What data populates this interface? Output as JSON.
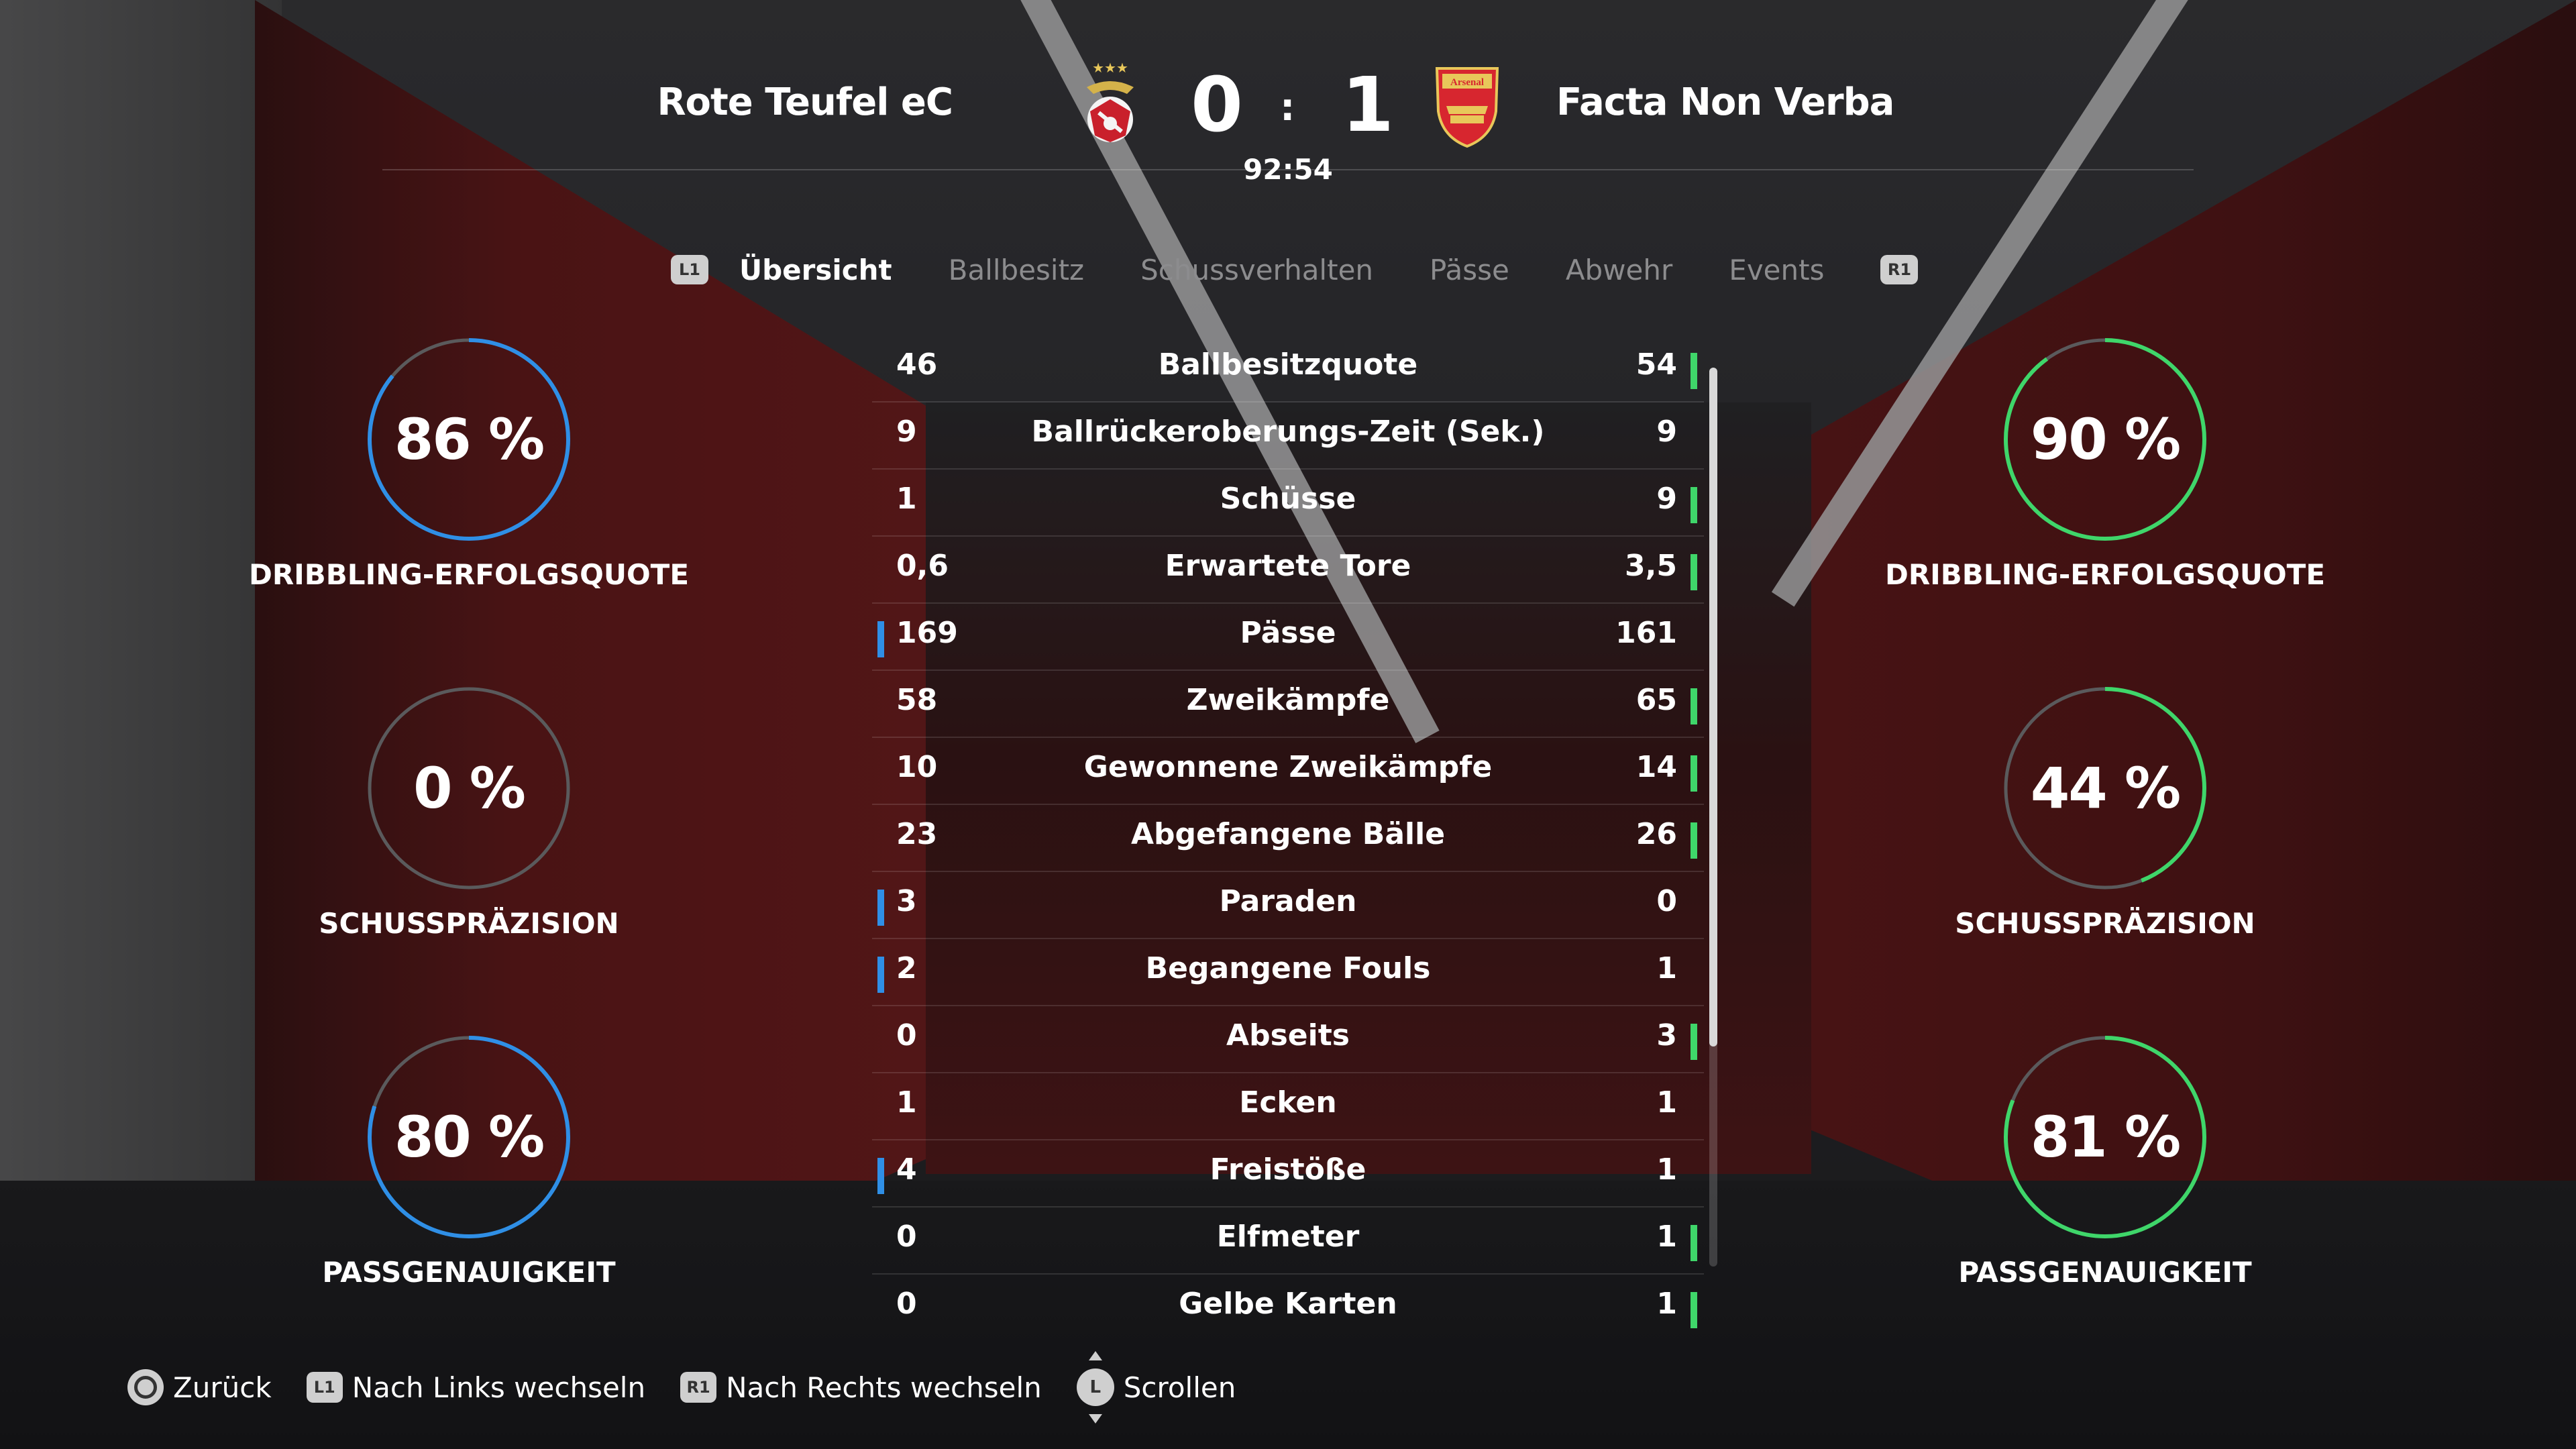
{
  "match": {
    "home_team": "Rote Teufel eC",
    "away_team": "Facta Non Verba",
    "home_score": "0",
    "separator": ":",
    "away_score": "1",
    "clock": "92:54",
    "home_crest": "benfica-crest-icon",
    "away_crest": "arsenal-crest-icon",
    "away_crest_text": "Arsenal"
  },
  "tabs": {
    "left_button": "L1",
    "right_button": "R1",
    "items": [
      "Übersicht",
      "Ballbesitz",
      "Schussverhalten",
      "Pässe",
      "Abwehr",
      "Events"
    ],
    "active": "Übersicht"
  },
  "stats": [
    {
      "name": "Ballbesitzquote",
      "home": "46",
      "away": "54",
      "lead": "away"
    },
    {
      "name": "Ballrückeroberungs-Zeit (Sek.)",
      "home": "9",
      "away": "9",
      "lead": "none"
    },
    {
      "name": "Schüsse",
      "home": "1",
      "away": "9",
      "lead": "away"
    },
    {
      "name": "Erwartete Tore",
      "home": "0,6",
      "away": "3,5",
      "lead": "away"
    },
    {
      "name": "Pässe",
      "home": "169",
      "away": "161",
      "lead": "home"
    },
    {
      "name": "Zweikämpfe",
      "home": "58",
      "away": "65",
      "lead": "away"
    },
    {
      "name": "Gewonnene Zweikämpfe",
      "home": "10",
      "away": "14",
      "lead": "away"
    },
    {
      "name": "Abgefangene Bälle",
      "home": "23",
      "away": "26",
      "lead": "away"
    },
    {
      "name": "Paraden",
      "home": "3",
      "away": "0",
      "lead": "home"
    },
    {
      "name": "Begangene Fouls",
      "home": "2",
      "away": "1",
      "lead": "home"
    },
    {
      "name": "Abseits",
      "home": "0",
      "away": "3",
      "lead": "away"
    },
    {
      "name": "Ecken",
      "home": "1",
      "away": "1",
      "lead": "none"
    },
    {
      "name": "Freistöße",
      "home": "4",
      "away": "1",
      "lead": "home"
    },
    {
      "name": "Elfmeter",
      "home": "0",
      "away": "1",
      "lead": "away"
    },
    {
      "name": "Gelbe Karten",
      "home": "0",
      "away": "1",
      "lead": "away"
    }
  ],
  "rings": {
    "home": [
      {
        "value": "86 %",
        "fraction": 0.86,
        "label": "DRIBBLING-ERFOLGSQUOTE"
      },
      {
        "value": "0 %",
        "fraction": 0.0,
        "label": "SCHUSSPRÄZISION"
      },
      {
        "value": "80 %",
        "fraction": 0.8,
        "label": "PASSGENAUIGKEIT"
      }
    ],
    "away": [
      {
        "value": "90 %",
        "fraction": 0.9,
        "label": "DRIBBLING-ERFOLGSQUOTE"
      },
      {
        "value": "44 %",
        "fraction": 0.44,
        "label": "SCHUSSPRÄZISION"
      },
      {
        "value": "81 %",
        "fraction": 0.81,
        "label": "PASSGENAUIGKEIT"
      }
    ]
  },
  "colors": {
    "home_accent": "#2f8fe6",
    "away_accent": "#3fd66a",
    "ring_track": "#5a5a5c"
  },
  "footer": {
    "back_label": "Zurück",
    "left_button": "L1",
    "left_label": "Nach Links wechseln",
    "right_button": "R1",
    "right_label": "Nach Rechts wechseln",
    "stick_button": "L",
    "scroll_label": "Scrollen"
  }
}
